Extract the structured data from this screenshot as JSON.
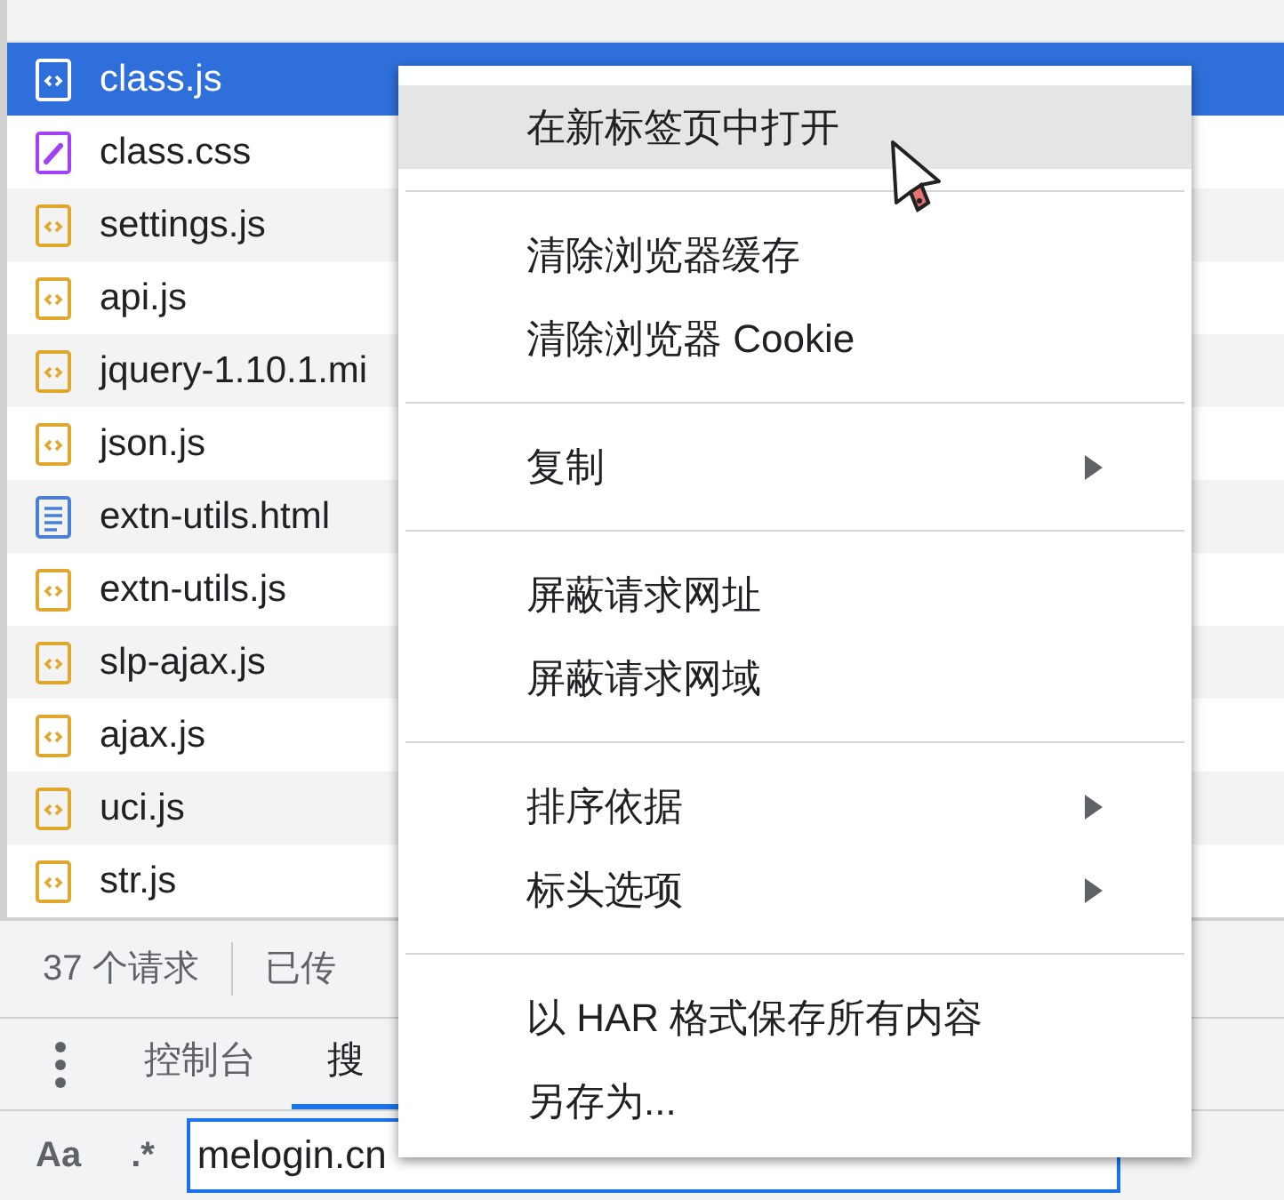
{
  "files": [
    {
      "name": "class.js",
      "kind": "script",
      "selected": true
    },
    {
      "name": "class.css",
      "kind": "stylesheet",
      "selected": false
    },
    {
      "name": "settings.js",
      "kind": "script",
      "selected": false
    },
    {
      "name": "api.js",
      "kind": "script",
      "selected": false
    },
    {
      "name": "jquery-1.10.1.mi",
      "kind": "script",
      "selected": false
    },
    {
      "name": "json.js",
      "kind": "script",
      "selected": false
    },
    {
      "name": "extn-utils.html",
      "kind": "document",
      "selected": false
    },
    {
      "name": "extn-utils.js",
      "kind": "script",
      "selected": false
    },
    {
      "name": "slp-ajax.js",
      "kind": "script",
      "selected": false
    },
    {
      "name": "ajax.js",
      "kind": "script",
      "selected": false
    },
    {
      "name": "uci.js",
      "kind": "script",
      "selected": false
    },
    {
      "name": "str.js",
      "kind": "script",
      "selected": false
    }
  ],
  "status_bar": {
    "requests": "37 个请求",
    "transferred": "已传"
  },
  "drawer_tabs": [
    {
      "label": "控制台",
      "selected": false
    },
    {
      "label": "搜",
      "selected": true
    }
  ],
  "search": {
    "case_toggle": "Aa",
    "regex_toggle": ".*",
    "value": "melogin.cn"
  },
  "context_menu": {
    "groups": [
      [
        {
          "label": "在新标签页中打开",
          "hovered": true,
          "submenu": false
        }
      ],
      [
        {
          "label": "清除浏览器缓存",
          "hovered": false,
          "submenu": false
        },
        {
          "label": "清除浏览器 Cookie",
          "hovered": false,
          "submenu": false
        }
      ],
      [
        {
          "label": "复制",
          "hovered": false,
          "submenu": true
        }
      ],
      [
        {
          "label": "屏蔽请求网址",
          "hovered": false,
          "submenu": false
        },
        {
          "label": "屏蔽请求网域",
          "hovered": false,
          "submenu": false
        }
      ],
      [
        {
          "label": "排序依据",
          "hovered": false,
          "submenu": true
        },
        {
          "label": "标头选项",
          "hovered": false,
          "submenu": true
        }
      ],
      [
        {
          "label": "以 HAR 格式保存所有内容",
          "hovered": false,
          "submenu": false
        },
        {
          "label": "另存为...",
          "hovered": false,
          "submenu": false
        }
      ]
    ]
  }
}
